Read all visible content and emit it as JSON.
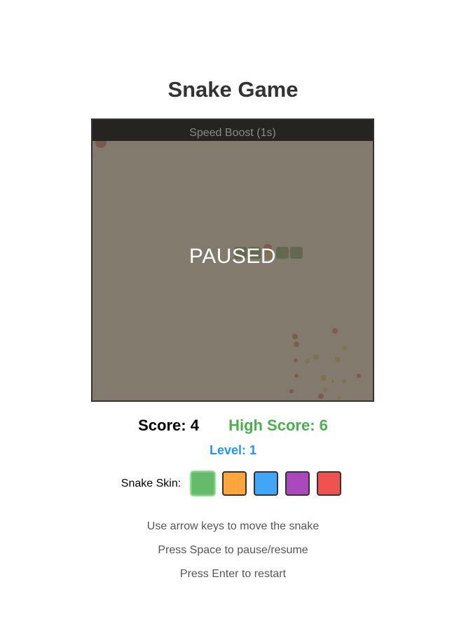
{
  "header": {
    "title": "Snake Game"
  },
  "board": {
    "powerup_text": "Speed Boost (1s)",
    "status_text": "PAUSED",
    "snake_color": "#2e7d32",
    "food_color": "#c62828",
    "overlay_color": "#6e6455"
  },
  "stats": {
    "score_text": "Score: 4",
    "high_score_text": "High Score: 6",
    "level_text": "Level: 1"
  },
  "skins": {
    "label": "Snake Skin:",
    "options": [
      {
        "name": "green",
        "color": "#66bb6a",
        "selected": true
      },
      {
        "name": "orange",
        "color": "#ffa53b",
        "selected": false
      },
      {
        "name": "blue",
        "color": "#42a5f5",
        "selected": false
      },
      {
        "name": "purple",
        "color": "#ab47bc",
        "selected": false
      },
      {
        "name": "red",
        "color": "#ef5350",
        "selected": false
      }
    ]
  },
  "instructions": {
    "line1": "Use arrow keys to move the snake",
    "line2": "Press Space to pause/resume",
    "line3": "Press Enter to restart"
  }
}
